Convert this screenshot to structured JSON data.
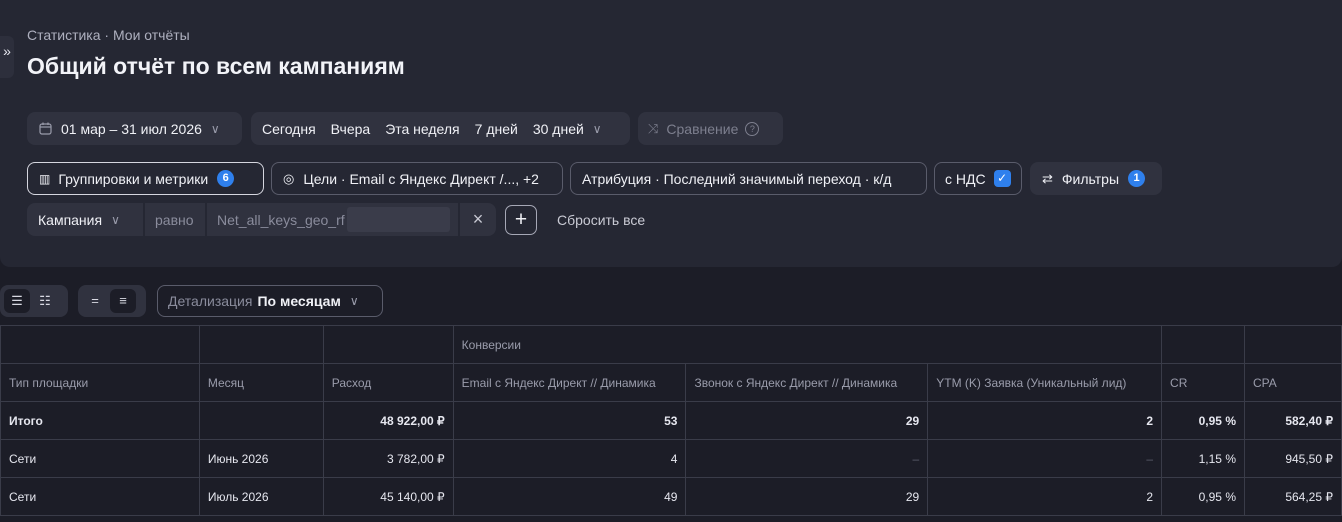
{
  "header": {
    "expand_icon": "»",
    "breadcrumb": "Статистика · Мои отчёты",
    "title": "Общий отчёт по всем кампаниям"
  },
  "period": {
    "date_range": "01 мар – 31 июл 2026",
    "quick": [
      "Сегодня",
      "Вчера",
      "Эта неделя",
      "7 дней",
      "30 дней"
    ],
    "compare": "Сравнение"
  },
  "settings": {
    "groupings_label": "Группировки и метрики",
    "groupings_count": "6",
    "goals_label": "Цели · Email с Яндекс Директ /..., +2",
    "attribution_label": "Атрибуция · Последний значимый переход · к/д",
    "vat_label": "с НДС",
    "filters_label": "Фильтры",
    "filters_count": "1"
  },
  "filter": {
    "field": "Кампания",
    "operator": "равно",
    "value": "Net_all_keys_geo_rf",
    "reset": "Сбросить все"
  },
  "view": {
    "detail_label": "Детализация",
    "detail_value": "По месяцам"
  },
  "table": {
    "group_header": "Конверсии",
    "columns": [
      "Тип площадки",
      "Месяц",
      "Расход",
      "Email с Яндекс Директ // Динамика",
      "Звонок с Яндекс Директ // Динамика",
      "YTM (K) Заявка (Уникальный лид)",
      "CR",
      "CPA"
    ],
    "rows": [
      {
        "type": "Итого",
        "month": "",
        "cost": "48 922,00 ₽",
        "email": "53",
        "call": "29",
        "lead": "2",
        "cr": "0,95 %",
        "cpa": "582,40 ₽"
      },
      {
        "type": "Сети",
        "month": "Июнь 2026",
        "cost": "3 782,00 ₽",
        "email": "4",
        "call": "–",
        "lead": "–",
        "cr": "1,15 %",
        "cpa": "945,50 ₽"
      },
      {
        "type": "Сети",
        "month": "Июль 2026",
        "cost": "45 140,00 ₽",
        "email": "49",
        "call": "29",
        "lead": "2",
        "cr": "0,95 %",
        "cpa": "564,25 ₽"
      }
    ]
  }
}
